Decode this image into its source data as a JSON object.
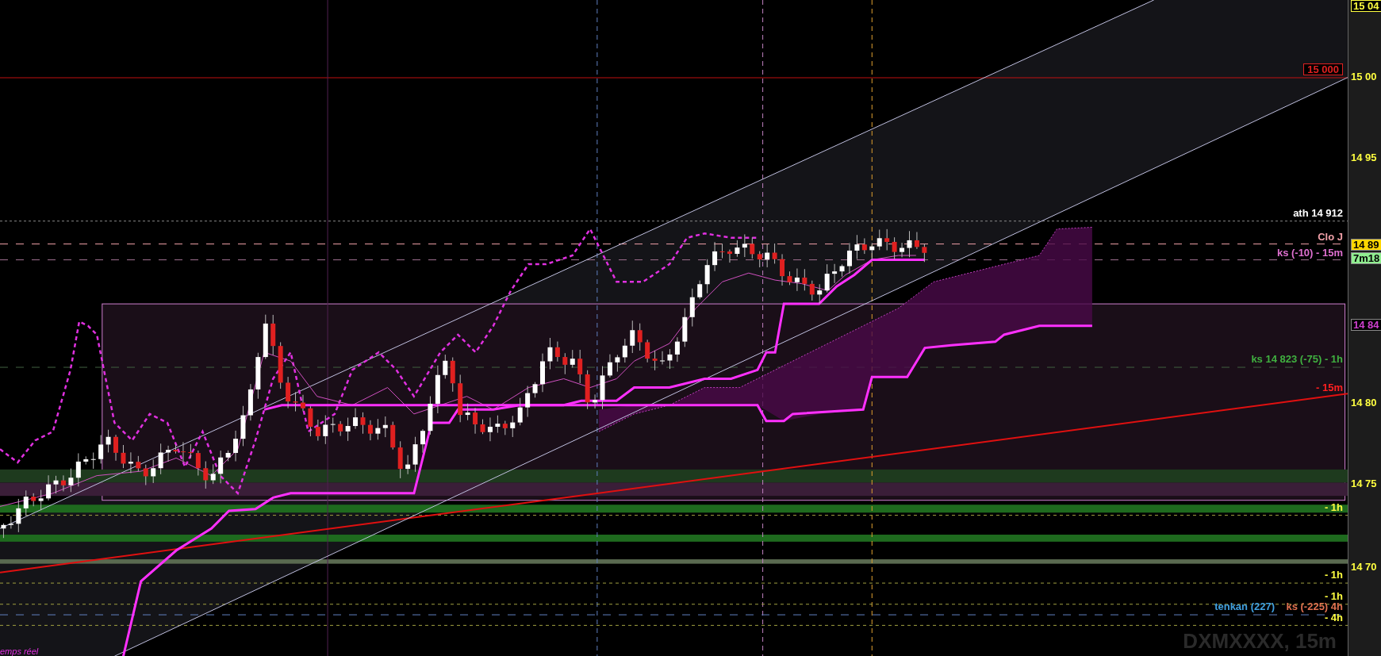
{
  "chart": {
    "watermark": "DXMXXXX, 15m",
    "footer_note": "emps réel",
    "line_labels": [
      {
        "text": "15 000",
        "color": "#e02020",
        "kind": "boxed"
      },
      {
        "text": "ath 14 912",
        "color": "#ffffff",
        "kind": "plain"
      },
      {
        "text": "Clo J",
        "color": "#f0a0a8",
        "kind": "plain"
      },
      {
        "text": "ks (-10) - 15m",
        "color": "#e070d0",
        "kind": "plain"
      },
      {
        "text": "ks 14 823 (-75) - 1h",
        "color": "#40b040",
        "kind": "plain"
      },
      {
        "text": "- 15m",
        "color": "#ff2020",
        "kind": "plain"
      },
      {
        "text": "- 1h",
        "color": "#ffff40",
        "kind": "plain"
      },
      {
        "text": "- 1h",
        "color": "#ffff40",
        "kind": "plain"
      },
      {
        "text": "- 1h",
        "color": "#ffff40",
        "kind": "plain"
      },
      {
        "text": "tenkan (227)",
        "color": "#40a0e0",
        "kind": "plain"
      },
      {
        "text": "ks (-225) 4h",
        "color": "#e07050",
        "kind": "plain"
      },
      {
        "text": "- 4h",
        "color": "#ffff40",
        "kind": "plain"
      }
    ]
  },
  "price_axis": {
    "labels": [
      {
        "text": "15 04",
        "kind": "last"
      },
      {
        "text": "15 00",
        "kind": "tick"
      },
      {
        "text": "14 95",
        "kind": "tick"
      },
      {
        "text": "14 89",
        "kind": "price"
      },
      {
        "text": "7m18",
        "kind": "timer"
      },
      {
        "text": "14 84",
        "kind": "marker"
      },
      {
        "text": "14 80",
        "kind": "tick"
      },
      {
        "text": "14 75",
        "kind": "tick"
      },
      {
        "text": "14 70",
        "kind": "tick"
      }
    ]
  }
}
